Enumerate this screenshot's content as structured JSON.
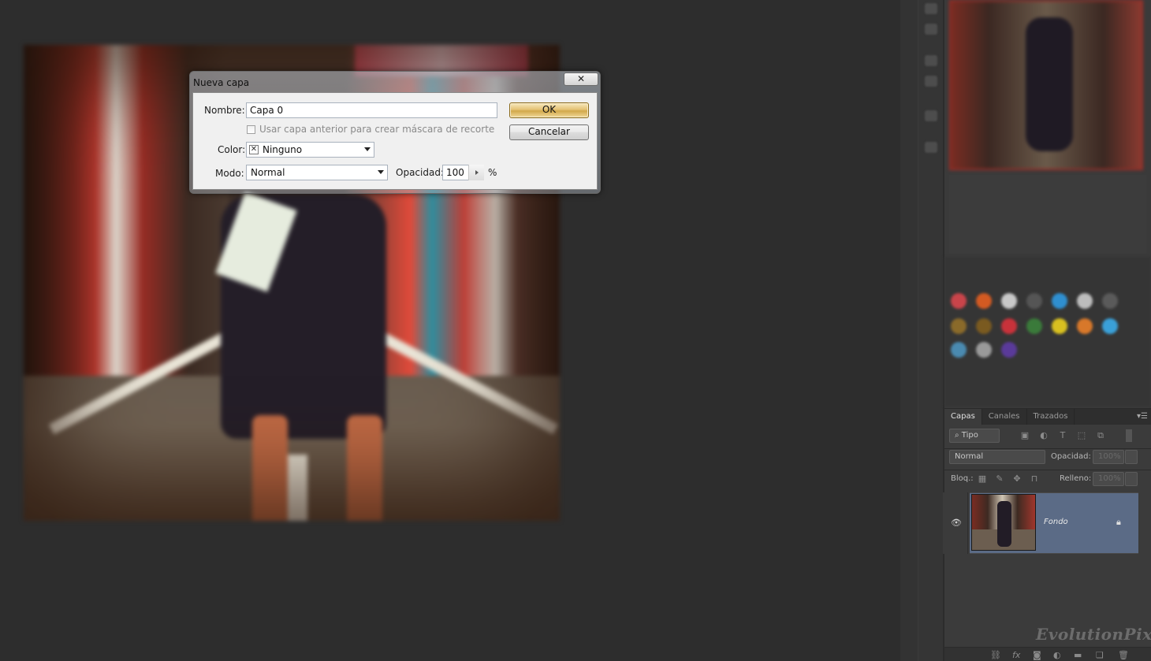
{
  "dialog": {
    "title": "Nueva capa",
    "close_glyph": "✕",
    "name_label": "Nombre:",
    "name_value": "Capa 0",
    "clip_mask_label": "Usar capa anterior para crear máscara de recorte",
    "clip_mask_checked": false,
    "color_label": "Color:",
    "color_value": "Ninguno",
    "mode_label": "Modo:",
    "mode_value": "Normal",
    "opacity_label": "Opacidad:",
    "opacity_value": "100",
    "opacity_unit": "%",
    "ok_label": "OK",
    "cancel_label": "Cancelar"
  },
  "layers_panel": {
    "tabs": [
      {
        "label": "Capas",
        "active": true
      },
      {
        "label": "Canales",
        "active": false
      },
      {
        "label": "Trazados",
        "active": false
      }
    ],
    "filter_kind": "Tipo",
    "blend_mode": "Normal",
    "opacity_label": "Opacidad:",
    "opacity_value": "100%",
    "lock_label": "Bloq.:",
    "fill_label": "Relleno:",
    "fill_value": "100%",
    "layers": [
      {
        "name": "Fondo",
        "visible": true,
        "locked": true,
        "selected": true
      }
    ]
  },
  "watermark": "EvolutionPix",
  "colors": {
    "workspace": "#2d2d2d",
    "panel": "#3b3b3b",
    "selected_layer": "#5b6b86",
    "ok_button": "#e4c274",
    "navigator_border": "#9e2c26"
  },
  "icons": {
    "eye": "eye-icon",
    "lock": "lock-icon",
    "close": "close-icon",
    "panel_menu": "panel-menu-icon"
  }
}
